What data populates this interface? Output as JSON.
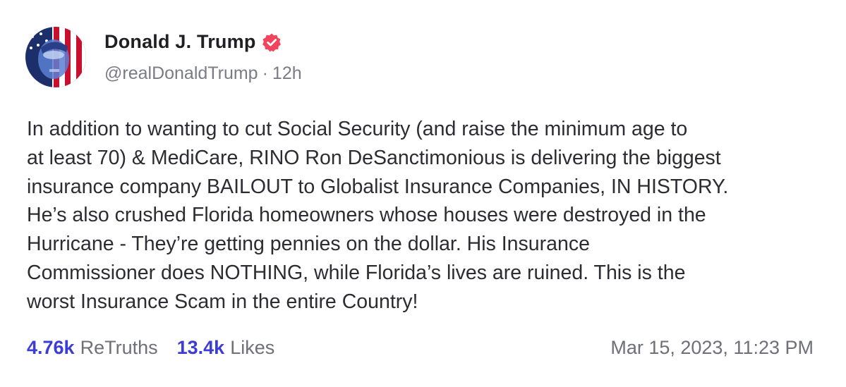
{
  "author": {
    "display_name": "Donald J. Trump",
    "handle": "@realDonaldTrump",
    "separator": "·",
    "time_ago": "12h",
    "verified": true,
    "avatar_icon": "flag-portrait-avatar"
  },
  "post": {
    "text": "In addition to wanting to cut Social Security (and raise the minimum age to\nat least 70) & MediCare, RINO Ron DeSanctimonious is delivering the biggest\ninsurance company BAILOUT to Globalist Insurance Companies, IN HISTORY.\nHe’s also crushed Florida homeowners whose houses were destroyed in the\nHurricane - They’re getting pennies on the dollar. His Insurance\nCommissioner does NOTHING, while Florida’s lives are ruined. This is the\nworst Insurance Scam in the entire Country!"
  },
  "stats": {
    "retruths_count": "4.76k",
    "retruths_label": "ReTruths",
    "likes_count": "13.4k",
    "likes_label": "Likes"
  },
  "timestamp": "Mar 15, 2023, 11:23 PM",
  "colors": {
    "accent": "#3b3dd6",
    "verified_badge": "#f0455d",
    "text": "#2c2c33",
    "muted": "#6f6f7a"
  }
}
